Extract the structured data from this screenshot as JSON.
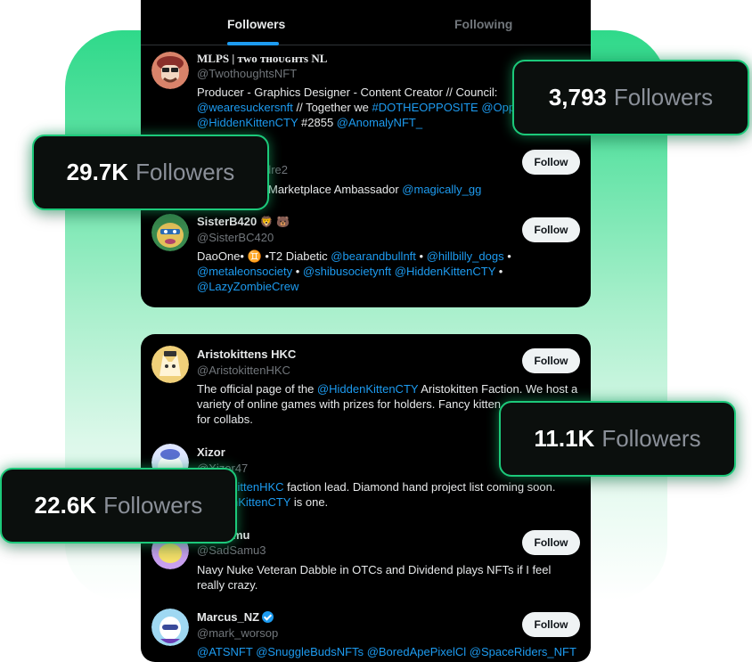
{
  "tabs": {
    "followers": "Followers",
    "following": "Following"
  },
  "card1": {
    "users": [
      {
        "name": "MLPS | ᴛᴡᴏ ᴛʜᴏᴜɢʜᴛs NL",
        "handle": "@TwothoughtsNFT",
        "bio_parts": [
          {
            "t": "Producer - Graphics Designer - Content Creator // Council: ",
            "link": false
          },
          {
            "t": "@wearesuckersnft",
            "link": true
          },
          {
            "t": " // Together we ",
            "link": false
          },
          {
            "t": "#DOTHEOPPOSITE",
            "link": true
          },
          {
            "t": " ",
            "link": false
          },
          {
            "t": "@Oppi",
            "link": true
          },
          {
            "t": " ",
            "link": false
          },
          {
            "t": "@HiddenKittenCTY",
            "link": true
          },
          {
            "t": " #2855 ",
            "link": false
          },
          {
            "t": "@AnomalyNFT_",
            "link": true
          }
        ],
        "avatar_color": "#c46a4a"
      },
      {
        "handle_partial": "dre2",
        "bio_parts": [
          {
            "t": "Marketplace Ambassador ",
            "link": false
          },
          {
            "t": "@magically_gg",
            "link": true
          }
        ],
        "follow": "Follow"
      },
      {
        "name": "SisterB420",
        "name_emoji": "🦁 🐻",
        "handle": "@SisterBC420",
        "bio_parts": [
          {
            "t": "DaoOne• ♊ •T2 Diabetic ",
            "link": false
          },
          {
            "t": "@bearandbullnft",
            "link": true
          },
          {
            "t": " • ",
            "link": false
          },
          {
            "t": "@hillbilly_dogs",
            "link": true
          },
          {
            "t": " • ",
            "link": false
          },
          {
            "t": "@metaleonsociety",
            "link": true
          },
          {
            "t": " • ",
            "link": false
          },
          {
            "t": "@shibusocietynft",
            "link": true
          },
          {
            "t": " ",
            "link": false
          },
          {
            "t": "@HiddenKittenCTY",
            "link": true
          },
          {
            "t": " • ",
            "link": false
          },
          {
            "t": "@LazyZombieCrew",
            "link": true
          }
        ],
        "follow": "Follow",
        "avatar_color": "#4fb36a"
      }
    ]
  },
  "card2": {
    "users": [
      {
        "name": "Aristokittens HKC",
        "handle": "@AristokittenHKC",
        "follow": "Follow",
        "bio_parts": [
          {
            "t": "The official page of the ",
            "link": false
          },
          {
            "t": "@HiddenKittenCTY",
            "link": true
          },
          {
            "t": " Aristokitten Faction. We host a variety of online games with prizes for holders. Fancy kitten",
            "link": false
          },
          {
            "t": " for collabs.",
            "link": false
          }
        ],
        "avatar_color": "#e8c46a"
      },
      {
        "name": "Xizor",
        "handle": "@Xizor47",
        "bio_parts": [
          {
            "t": "kittenHKC",
            "link": true
          },
          {
            "t": " faction lead. Diamond hand project list coming soon.",
            "link": false
          },
          {
            "t": " ",
            "link": false
          },
          {
            "t": "nKittenCTY",
            "link": true
          },
          {
            "t": " is one.",
            "link": false
          }
        ],
        "avatar_color": "#c9d4ff"
      },
      {
        "name": "mu",
        "handle": "@SadSamu3",
        "follow": "Follow",
        "bio_parts": [
          {
            "t": "Navy Nuke Veteran Dabble in OTCs and Dividend plays NFTs if I feel really crazy.",
            "link": false
          }
        ],
        "avatar_color": "#d6b3ff"
      },
      {
        "name": "Marcus_NZ",
        "handle": "@mark_worsop",
        "follow": "Follow",
        "bio_parts": [
          {
            "t": "@ATSNFT",
            "link": true
          },
          {
            "t": " ",
            "link": false
          },
          {
            "t": "@SnuggleBudsNFTs",
            "link": true
          },
          {
            "t": " ",
            "link": false
          },
          {
            "t": "@BoredApePixelCl",
            "link": true
          },
          {
            "t": " ",
            "link": false
          },
          {
            "t": "@SpaceRiders_NFT",
            "link": true
          }
        ],
        "avatar_color": "#7fd1ff"
      }
    ]
  },
  "badges": [
    {
      "num": "3,793",
      "label": "Followers"
    },
    {
      "num": "29.7K",
      "label": "Followers"
    },
    {
      "num": "11.1K",
      "label": "Followers"
    },
    {
      "num": "22.6K",
      "label": "Followers"
    }
  ],
  "colors": {
    "accent_green": "#1cc97a",
    "link_blue": "#1d9bf0",
    "card_bg": "#000000"
  }
}
